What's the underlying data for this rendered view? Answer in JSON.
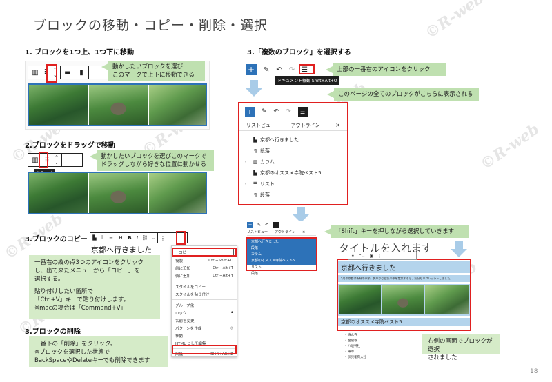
{
  "title": "ブロックの移動・コピー・削除・選択",
  "page_number": "18",
  "watermark": "©R-web",
  "section1": {
    "heading": "1. ブロックを1つ上、1つ下に移動",
    "bubble_line1": "動かしたいブロックを選び",
    "bubble_line2": "このマークで上下に移動できる"
  },
  "section2": {
    "heading": "2.ブロックをドラッグで移動",
    "bubble_line1": "動かしたいブロックを選びこのマークで",
    "bubble_line2": "ドラッグしながら好きな位置に動かせる",
    "tooltip": "ドラッグ"
  },
  "section3": {
    "heading": "3.ブロックのコピー",
    "block_text": "京都へ行きました",
    "note_line1": "一番右の縦の点3つのアイコンをクリック",
    "note_line2": "し、出て来たメニューから「コピー」を",
    "note_line3": "選択する。",
    "note_line4": "貼り付けしたい箇所で",
    "note_line5": "「Ctrl+V」キーで貼り付けします。",
    "note_line6": "※macの場合は「Command+V」",
    "menu": [
      {
        "label": "コピー",
        "shortcut": ""
      },
      {
        "label": "複製",
        "shortcut": "Ctrl+Shift+D"
      },
      {
        "label": "前に追加",
        "shortcut": "Ctrl+Alt+T"
      },
      {
        "label": "後に追加",
        "shortcut": "Ctrl+Alt+Y"
      },
      {
        "label": "スタイルをコピー",
        "shortcut": ""
      },
      {
        "label": "スタイルを貼り付け",
        "shortcut": ""
      },
      {
        "label": "グループ化",
        "shortcut": ""
      },
      {
        "label": "ロック",
        "shortcut": ""
      },
      {
        "label": "名前を変更",
        "shortcut": ""
      },
      {
        "label": "パターンを作成",
        "shortcut": ""
      },
      {
        "label": "移動",
        "shortcut": ""
      },
      {
        "label": "HTML として編集",
        "shortcut": ""
      },
      {
        "label": "削除",
        "shortcut": "Shift+Alt+Z"
      }
    ]
  },
  "section4": {
    "heading": "3.ブロックの削除",
    "note_line1": "一番下の「削除」をクリック。",
    "note_line2": "※ブロックを選択した状態で",
    "note_line3": "BackSpaceやDelateキーでも削除できます"
  },
  "section5": {
    "heading": "3.「複数のブロック」を選択する",
    "bubble_top": "上部の一番右のアイコンをクリック",
    "tooltip": "ドキュメント概観 Shift+Alt+O",
    "bubble_panel": "このページの全てのブロックがこちらに表示される",
    "tab_list": "リストビュー",
    "tab_outline": "アウトライン",
    "close": "×",
    "list_items": [
      {
        "icon": "bookmark",
        "label": "京都へ行きました",
        "indent": false
      },
      {
        "icon": "pilcrow",
        "label": "段落",
        "indent": false
      },
      {
        "icon": "columns",
        "label": "カラム",
        "indent": true
      },
      {
        "icon": "bookmark",
        "label": "京都のオススメ寺院ベスト5",
        "indent": false
      },
      {
        "icon": "list",
        "label": "リスト",
        "indent": true
      },
      {
        "icon": "pilcrow",
        "label": "段落",
        "indent": false
      }
    ],
    "bubble_shift": "「Shift」キーを押しながら選択していきます",
    "editor_title": "タイトルを入れます",
    "heading1": "京都へ行きました",
    "paragraph": "5月の京都は新緑の季節。爽やかな空気の中を散策すると、気分もリフレッシュしました。",
    "heading2": "京都のオススメ寺院ベスト5",
    "temples": [
      "清水寺",
      "金閣寺",
      "八坂神社",
      "東寺",
      "伏見稲荷大社"
    ],
    "note_right_line1": "右側の画面でブロックが選択",
    "note_right_line2": "されました"
  }
}
